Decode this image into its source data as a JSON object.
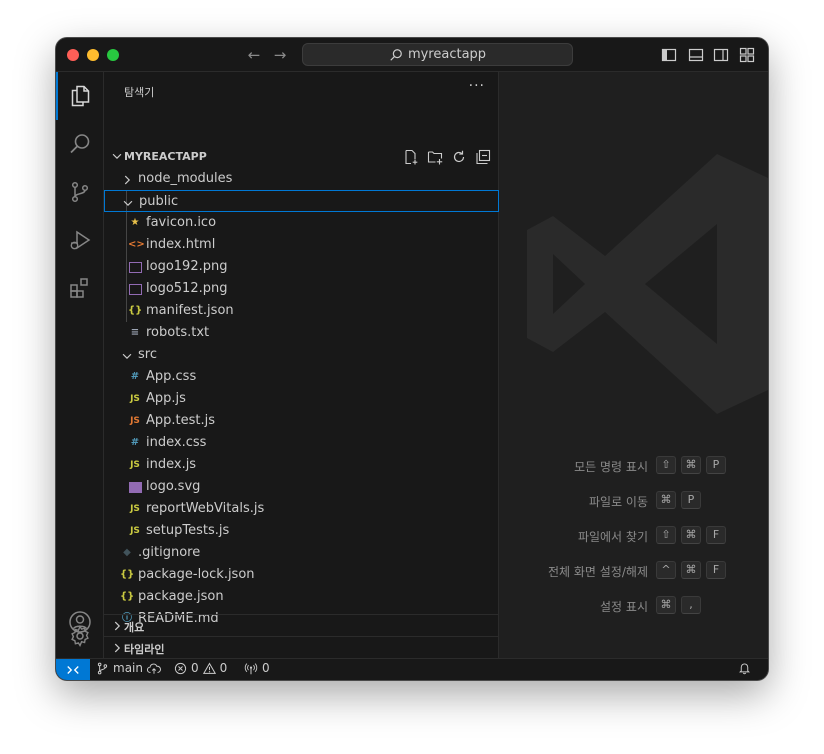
{
  "window": {
    "search_text": "myreactapp"
  },
  "sidebar": {
    "title": "탐색기",
    "more": "···",
    "project_name": "MYREACTAPP",
    "tree": [
      {
        "name": "node_modules",
        "depth": 0,
        "type": "folder",
        "expanded": false,
        "icon": "chevron-right-icon"
      },
      {
        "name": "public",
        "depth": 0,
        "type": "folder",
        "expanded": true,
        "selected": true
      },
      {
        "name": "favicon.ico",
        "depth": 1,
        "icon": "star-icon",
        "glyph": "★",
        "color": "#e8c04a"
      },
      {
        "name": "index.html",
        "depth": 1,
        "icon": "html-icon",
        "glyph": "<>",
        "color": "#e37933"
      },
      {
        "name": "logo192.png",
        "depth": 1,
        "icon": "image-icon",
        "glyph": "img",
        "color": "#a074c4"
      },
      {
        "name": "logo512.png",
        "depth": 1,
        "icon": "image-icon",
        "glyph": "img",
        "color": "#a074c4"
      },
      {
        "name": "manifest.json",
        "depth": 1,
        "icon": "json-icon",
        "glyph": "{}",
        "color": "#cbcb41"
      },
      {
        "name": "robots.txt",
        "depth": 1,
        "icon": "text-file-icon",
        "glyph": "≡",
        "color": "#9da5b4"
      },
      {
        "name": "src",
        "depth": 0,
        "type": "folder",
        "expanded": true
      },
      {
        "name": "App.css",
        "depth": 1,
        "icon": "css-icon",
        "glyph": "#",
        "color": "#519aba"
      },
      {
        "name": "App.js",
        "depth": 1,
        "icon": "js-icon",
        "glyph": "JS",
        "color": "#cbcb41"
      },
      {
        "name": "App.test.js",
        "depth": 1,
        "icon": "js-test-icon",
        "glyph": "JS",
        "color": "#e37933"
      },
      {
        "name": "index.css",
        "depth": 1,
        "icon": "css-icon",
        "glyph": "#",
        "color": "#519aba"
      },
      {
        "name": "index.js",
        "depth": 1,
        "icon": "js-icon",
        "glyph": "JS",
        "color": "#cbcb41"
      },
      {
        "name": "logo.svg",
        "depth": 1,
        "icon": "svg-icon",
        "glyph": "svg",
        "color": "#a074c4"
      },
      {
        "name": "reportWebVitals.js",
        "depth": 1,
        "icon": "js-icon",
        "glyph": "JS",
        "color": "#cbcb41"
      },
      {
        "name": "setupTests.js",
        "depth": 1,
        "icon": "js-icon",
        "glyph": "JS",
        "color": "#cbcb41"
      },
      {
        "name": ".gitignore",
        "depth": 0,
        "icon": "git-icon",
        "glyph": "◆",
        "color": "#41535b"
      },
      {
        "name": "package-lock.json",
        "depth": 0,
        "icon": "json-icon",
        "glyph": "{}",
        "color": "#cbcb41"
      },
      {
        "name": "package.json",
        "depth": 0,
        "icon": "json-icon",
        "glyph": "{}",
        "color": "#cbcb41"
      },
      {
        "name": "README.md",
        "depth": 0,
        "icon": "info-icon",
        "glyph": "ⓘ",
        "color": "#519aba"
      }
    ],
    "outline_label": "개요",
    "timeline_label": "타임라인"
  },
  "editor": {
    "shortcuts": [
      {
        "label": "모든 명령 표시",
        "keys": [
          "⇧",
          "⌘",
          "P"
        ]
      },
      {
        "label": "파일로 이동",
        "keys": [
          "⌘",
          "P"
        ]
      },
      {
        "label": "파일에서 찾기",
        "keys": [
          "⇧",
          "⌘",
          "F"
        ]
      },
      {
        "label": "전체 화면 설정/해제",
        "keys": [
          "^",
          "⌘",
          "F"
        ]
      },
      {
        "label": "설정 표시",
        "keys": [
          "⌘",
          ","
        ]
      }
    ]
  },
  "statusbar": {
    "branch": "main",
    "errors": "0",
    "warnings": "0",
    "ports": "0"
  },
  "colors": {
    "accent": "#0078d4",
    "sidebar_bg": "#181818",
    "editor_bg": "#1f1f1f"
  }
}
